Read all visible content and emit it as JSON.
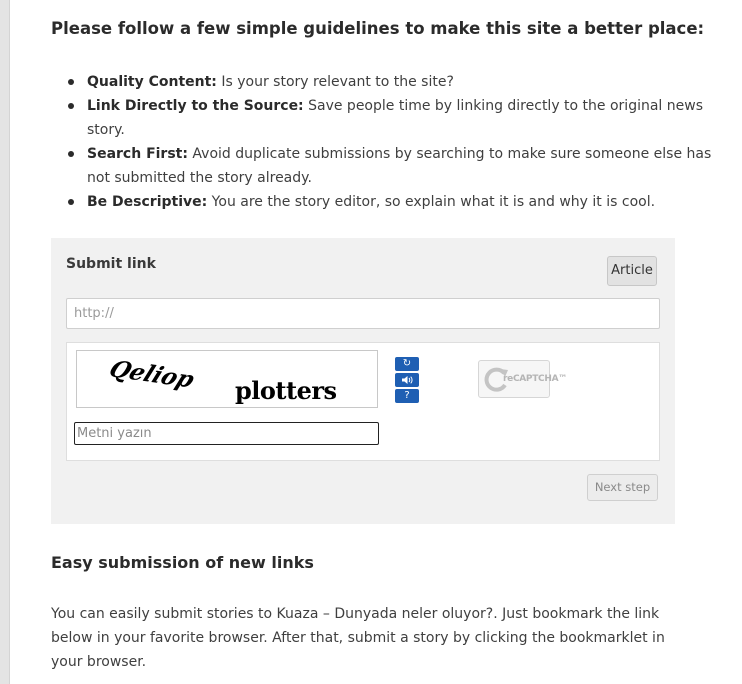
{
  "guidelines": {
    "heading": "Please follow a few simple guidelines to make this site a better place:",
    "items": [
      {
        "title": "Quality Content:",
        "text": " Is your story relevant to the site?"
      },
      {
        "title": "Link Directly to the Source:",
        "text": " Save people time by linking directly to the original news story."
      },
      {
        "title": "Search First:",
        "text": " Avoid duplicate submissions by searching to make sure someone else has not submitted the story already."
      },
      {
        "title": "Be Descriptive:",
        "text": " You are the story editor, so explain what it is and why it is cool."
      }
    ]
  },
  "submit": {
    "title": "Submit link",
    "article_label": "Article",
    "url_placeholder": "http://",
    "next_label": "Next step"
  },
  "captcha": {
    "word_distorted": "Qeliop",
    "word_plain": "plotters",
    "input_placeholder": "Metni yazın",
    "logo_text": "reCAPTCHA™",
    "controls": [
      {
        "name": "refresh-icon",
        "glyph": "↻"
      },
      {
        "name": "audio-icon",
        "glyph": "🔊"
      },
      {
        "name": "help-icon",
        "glyph": "?"
      }
    ],
    "accent_color": "#1f5fb3"
  },
  "easy": {
    "heading": "Easy submission of new links",
    "text": "You can easily submit stories to Kuaza – Dunyada neler oluyor?. Just bookmark the link below in your favorite browser. After that, submit a story by clicking the bookmarklet in your browser."
  }
}
